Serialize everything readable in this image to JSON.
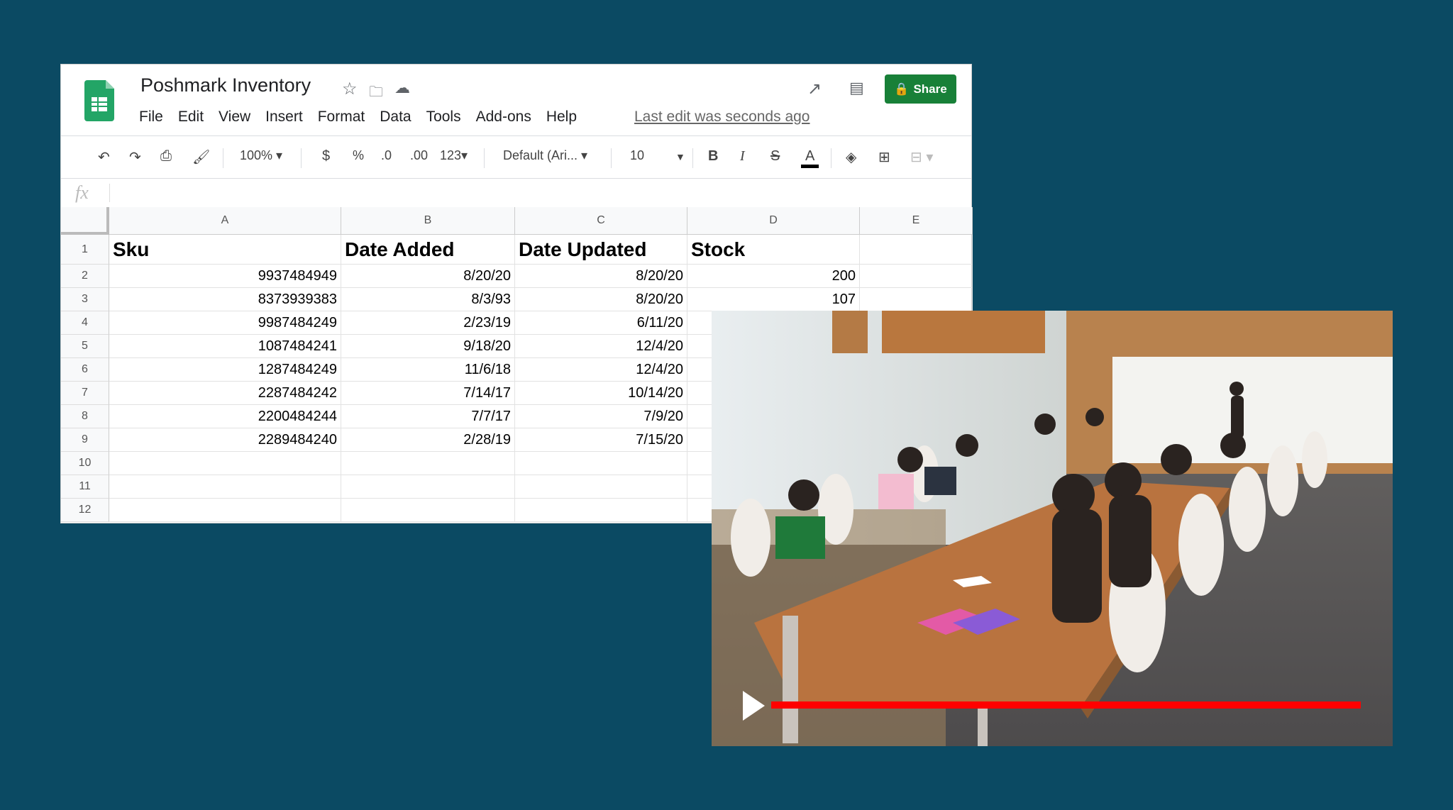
{
  "app": {
    "title": "Poshmark Inventory",
    "share_label": "Share",
    "last_edit": "Last edit was seconds ago"
  },
  "menu": [
    "File",
    "Edit",
    "View",
    "Insert",
    "Format",
    "Data",
    "Tools",
    "Add-ons",
    "Help"
  ],
  "toolbar": {
    "zoom": "100%",
    "currency": "$",
    "percent": "%",
    "dec_decrease": ".0",
    "dec_increase": ".00",
    "more_formats": "123",
    "font": "Default (Ari...",
    "font_size": "10",
    "bold": "B",
    "italic": "I",
    "strike": "S",
    "text_color": "A"
  },
  "formula_bar": {
    "label": "fx",
    "value": ""
  },
  "columns": [
    "A",
    "B",
    "C",
    "D",
    "E"
  ],
  "rows": [
    "1",
    "2",
    "3",
    "4",
    "5",
    "6",
    "7",
    "8",
    "9",
    "10",
    "11",
    "12"
  ],
  "headers": [
    "Sku",
    "Date Added",
    "Date Updated",
    "Stock",
    ""
  ],
  "data": [
    [
      "9937484949",
      "8/20/20",
      "8/20/20",
      "200"
    ],
    [
      "8373939383",
      "8/3/93",
      "8/20/20",
      "107"
    ],
    [
      "9987484249",
      "2/23/19",
      "6/11/20",
      ""
    ],
    [
      "1087484241",
      "9/18/20",
      "12/4/20",
      ""
    ],
    [
      "1287484249",
      "11/6/18",
      "12/4/20",
      ""
    ],
    [
      "2287484242",
      "7/14/17",
      "10/14/20",
      ""
    ],
    [
      "2200484244",
      "7/7/17",
      "7/9/20",
      ""
    ],
    [
      "2289484240",
      "2/28/19",
      "7/15/20",
      ""
    ]
  ],
  "video": {
    "progress": 1.0,
    "progress_color": "#ff0000"
  },
  "colors": {
    "background": "#0b4a63",
    "share": "#188038"
  }
}
